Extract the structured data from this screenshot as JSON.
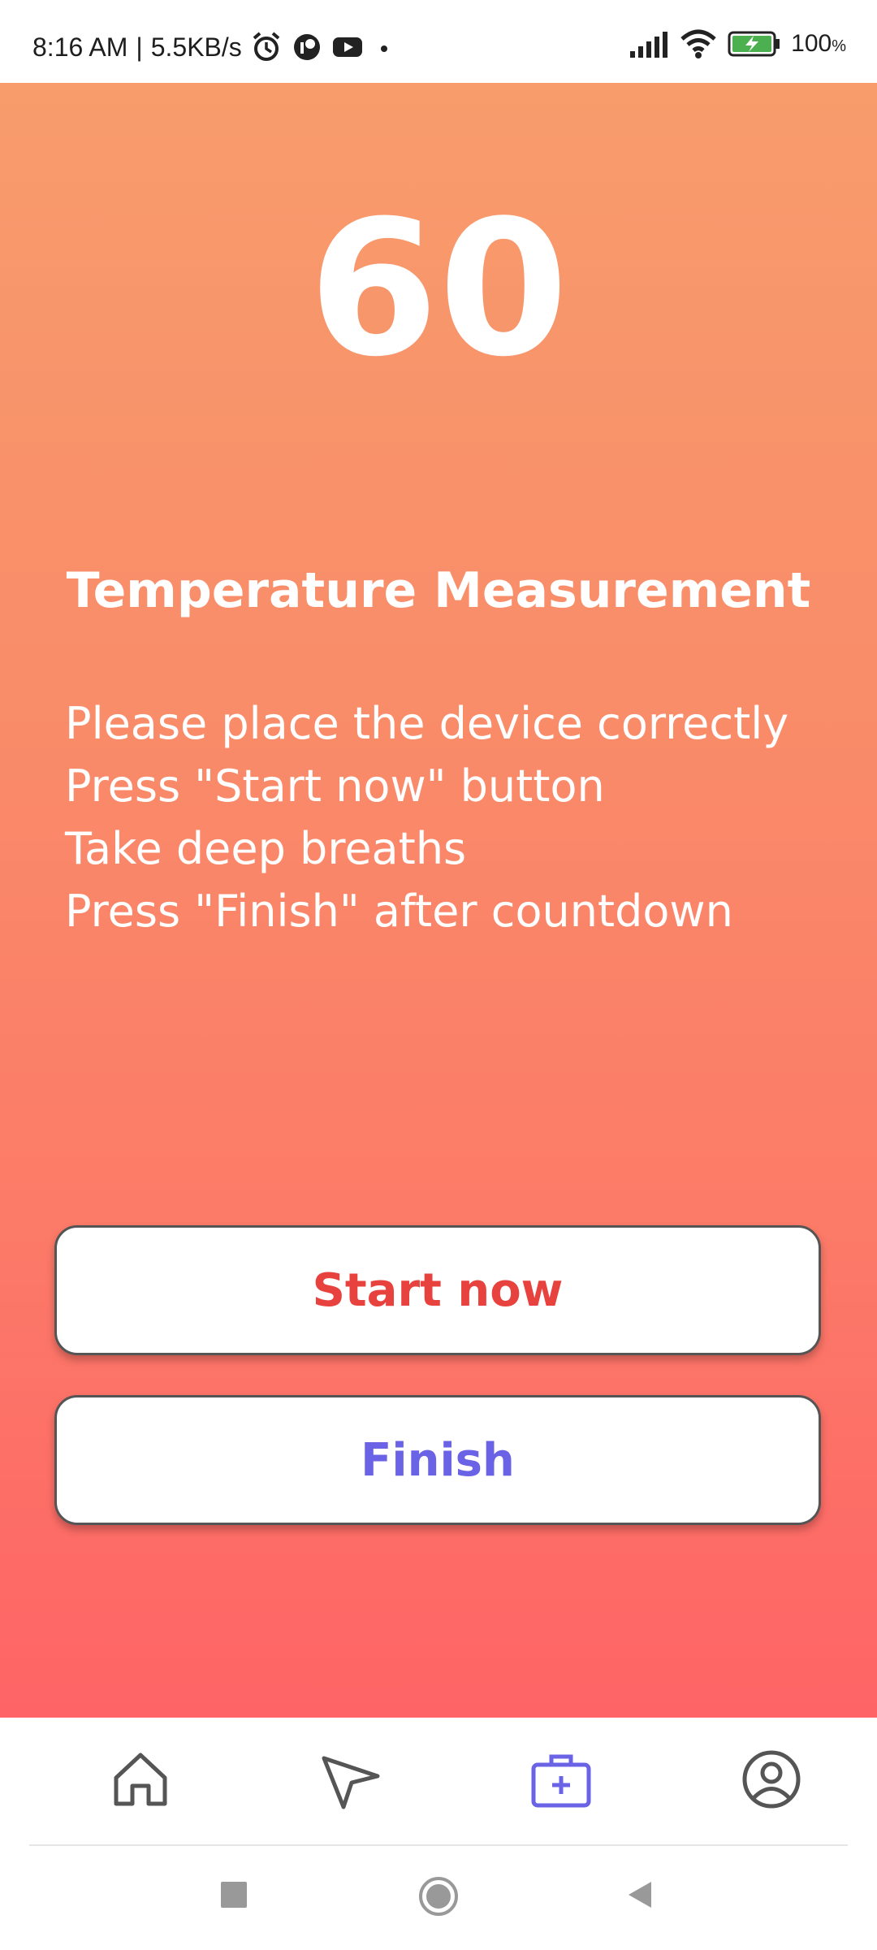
{
  "status_bar": {
    "time": "8:16 AM",
    "separator": "|",
    "speed": "5.5KB/s",
    "battery": "100",
    "battery_unit": "%",
    "icons": [
      "alarm-icon",
      "app-icon",
      "youtube-icon",
      "dot-icon",
      "signal-icon",
      "wifi-icon",
      "battery-charging-icon"
    ]
  },
  "measurement": {
    "countdown": "60",
    "title": "Temperature Measurement",
    "instructions": [
      "Please place the device correctly",
      "Press \"Start now\" button",
      "Take deep breaths",
      "Press \"Finish\" after countdown"
    ]
  },
  "buttons": {
    "start_label": "Start now",
    "finish_label": "Finish"
  },
  "bottom_nav": {
    "items": [
      "home-icon",
      "send-icon",
      "medical-kit-icon",
      "profile-icon"
    ],
    "active": "medical-kit-icon"
  },
  "colors": {
    "gradient_top": "#f89c6c",
    "gradient_bottom": "#fe6466",
    "start_text": "#e8423f",
    "finish_text": "#6a63e6",
    "nav_active": "#6a63e6",
    "nav_inactive": "#555555"
  }
}
